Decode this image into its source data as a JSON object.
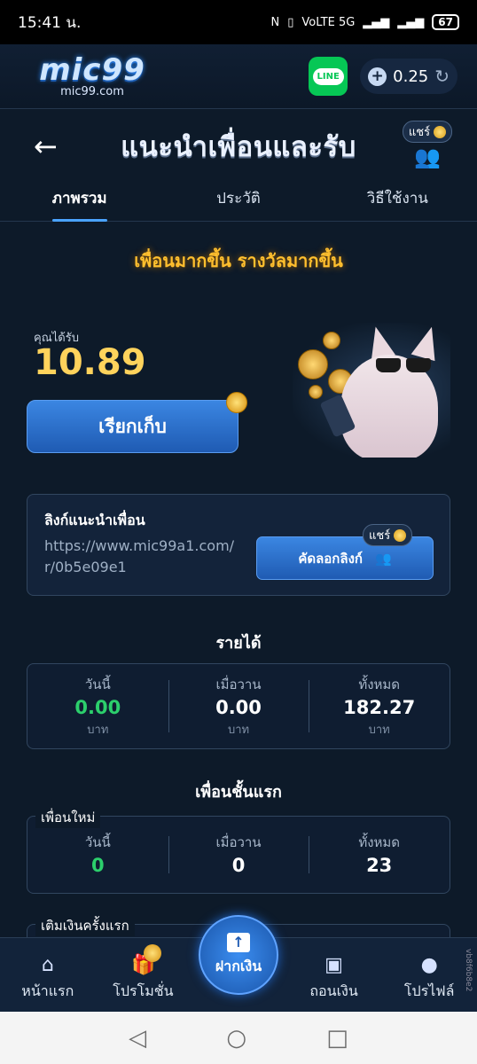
{
  "status_bar": {
    "time": "15:41 น.",
    "network": "VoLTE 5G",
    "battery": "67"
  },
  "header": {
    "logo_text": "mic99",
    "logo_domain": "mic99.com",
    "line_label": "LINE",
    "balance": "0.25"
  },
  "title_bar": {
    "title": "แนะนำเพื่อนและรับ",
    "share_label": "แชร์"
  },
  "tabs": [
    {
      "label": "ภาพรวม"
    },
    {
      "label": "ประวัติ"
    },
    {
      "label": "วิธีใช้งาน"
    }
  ],
  "headline": "เพื่อนมากขึ้น รางวัลมากขึ้น",
  "reward": {
    "label": "คุณได้รับ",
    "amount": "10.89",
    "claim_button": "เรียกเก็บ"
  },
  "referral_link": {
    "title": "ลิงก์แนะนำเพื่อน",
    "url": "https://www.mic99a1.com/r/0b5e09e1",
    "copy_button": "คัดลอกลิงก์",
    "share_label": "แชร์"
  },
  "income": {
    "title": "รายได้",
    "stats": [
      {
        "label": "วันนี้",
        "value": "0.00",
        "unit": "บาท"
      },
      {
        "label": "เมื่อวาน",
        "value": "0.00",
        "unit": "บาท"
      },
      {
        "label": "ทั้งหมด",
        "value": "182.27",
        "unit": "บาท"
      }
    ]
  },
  "first_tier_friends": {
    "title": "เพื่อนชั้นแรก",
    "new_friends": {
      "legend": "เพื่อนใหม่",
      "stats": [
        {
          "label": "วันนี้",
          "value": "0"
        },
        {
          "label": "เมื่อวาน",
          "value": "0"
        },
        {
          "label": "ทั้งหมด",
          "value": "23"
        }
      ]
    },
    "first_deposit": {
      "legend": "เติมเงินครั้งแรก"
    }
  },
  "bottom_nav": {
    "items": [
      {
        "label": "หน้าแรก",
        "icon": "home-icon"
      },
      {
        "label": "โปรโมชั่น",
        "icon": "gift-icon"
      },
      {
        "label": "ฝากเงิน",
        "icon": "deposit-icon"
      },
      {
        "label": "ถอนเงิน",
        "icon": "wallet-icon"
      },
      {
        "label": "โปรไฟล์",
        "icon": "profile-icon"
      }
    ],
    "side_tag": "vb8f6b8e2"
  },
  "colors": {
    "accent_blue": "#2f74d0",
    "gold": "#ffd35c",
    "green": "#2ccf6c",
    "line_green": "#06c755"
  }
}
